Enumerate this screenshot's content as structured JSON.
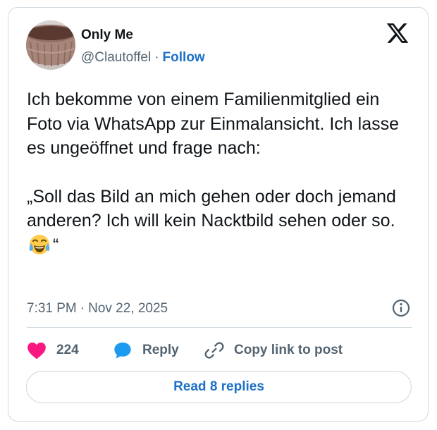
{
  "author": {
    "display_name": "Only Me",
    "handle": "@Clautoffel",
    "separator": "·",
    "follow_label": "Follow",
    "avatar_icon": "bowl-photo-avatar"
  },
  "brand": {
    "logo_icon": "x-logo-icon",
    "color": "#0f1419"
  },
  "tweet": {
    "paragraph1": "Ich bekomme von einem Familienmitglied ein Foto via WhatsApp zur Einmalansicht. Ich lasse es ungeöffnet und frage nach:",
    "paragraph2_main": "„Soll das Bild an mich gehen oder doch jemand anderen? Ich will kein Nacktbild sehen oder so.",
    "paragraph2_emoji": "face-with-tears-of-joy-emoji",
    "paragraph2_end": "“"
  },
  "meta": {
    "time": "7:31 PM",
    "separator": "·",
    "date": "Nov 22, 2025",
    "info_icon": "info-icon"
  },
  "actions": {
    "like_count": "224",
    "like_icon": "heart-icon",
    "reply_label": "Reply",
    "reply_icon": "speech-bubble-icon",
    "copy_label": "Copy link to post",
    "copy_icon": "link-icon"
  },
  "footer": {
    "read_replies_label": "Read 8 replies"
  },
  "colors": {
    "link_blue": "#1d71c6",
    "like_pink": "#f91880",
    "reply_blue": "#1d9bf0",
    "muted_text": "#536471",
    "border": "#cfd9de"
  }
}
